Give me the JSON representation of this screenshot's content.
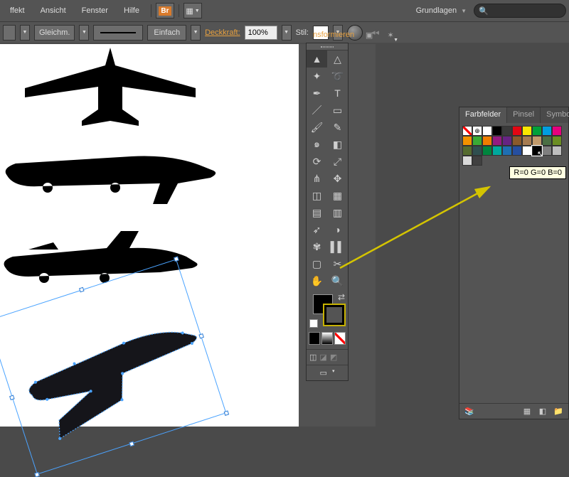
{
  "menu": {
    "effekt": "ffekt",
    "ansicht": "Ansicht",
    "fenster": "Fenster",
    "hilfe": "Hilfe"
  },
  "menubar": {
    "br_label": "Br"
  },
  "workspace": {
    "label": "Grundlagen"
  },
  "search": {
    "placeholder": ""
  },
  "control": {
    "stroke_weight": "",
    "uniform": "Gleichm.",
    "profile": "Einfach",
    "opacity_label": "Deckkraft:",
    "opacity_value": "100%",
    "style_label": "Stil:"
  },
  "tabs": {
    "transform": "nsformieren"
  },
  "swatches": {
    "tabs": {
      "farbfelder": "Farbfelder",
      "pinsel": "Pinsel",
      "symbol": "Symbol"
    },
    "tooltip": "R=0 G=0 B=0",
    "colors": [
      "#ffffff",
      "#000000",
      "#3a3a3a",
      "#e30613",
      "#f9e700",
      "#00a13a",
      "#009ee0",
      "#e6007e",
      "#f39200",
      "#3aaa35",
      "#ef7d00",
      "#951b81",
      "#662483",
      "#8b5a2b",
      "#a67c52",
      "#c19a6b",
      "#4b6f44",
      "#6b8e23",
      "#556b2f",
      "#2f4f4f",
      "#00853e",
      "#00a99d",
      "#1f6fb2",
      "#264fa0",
      "#ffffff",
      "#000000",
      "#7f7f7f",
      "#bfbfbf",
      "#d9d9d9",
      "#404040"
    ]
  },
  "tools": {
    "rows": [
      [
        "selection",
        "direct-selection"
      ],
      [
        "magic-wand",
        "lasso"
      ],
      [
        "pen",
        "type"
      ],
      [
        "line-segment",
        "rectangle"
      ],
      [
        "paintbrush",
        "pencil"
      ],
      [
        "blob-brush",
        "eraser"
      ],
      [
        "rotate",
        "scale"
      ],
      [
        "width",
        "free-transform"
      ],
      [
        "shape-builder",
        "perspective-grid"
      ],
      [
        "mesh",
        "gradient"
      ],
      [
        "eyedropper",
        "blend"
      ],
      [
        "symbol-sprayer",
        "column-graph"
      ],
      [
        "artboard",
        "slice"
      ],
      [
        "hand",
        "zoom"
      ]
    ],
    "glyphs": {
      "selection": "▲",
      "direct-selection": "△",
      "magic-wand": "✦",
      "lasso": "➰",
      "pen": "✒",
      "type": "T",
      "line-segment": "／",
      "rectangle": "▭",
      "paintbrush": "🖌",
      "pencil": "✎",
      "blob-brush": "๑",
      "eraser": "◧",
      "rotate": "⟳",
      "scale": "⤢",
      "width": "⋔",
      "free-transform": "✥",
      "shape-builder": "◫",
      "perspective-grid": "▦",
      "mesh": "▤",
      "gradient": "▥",
      "eyedropper": "➶",
      "blend": "◑",
      "symbol-sprayer": "✾",
      "column-graph": "▌▌",
      "artboard": "▢",
      "slice": "✂",
      "hand": "✋",
      "zoom": "🔍"
    }
  }
}
